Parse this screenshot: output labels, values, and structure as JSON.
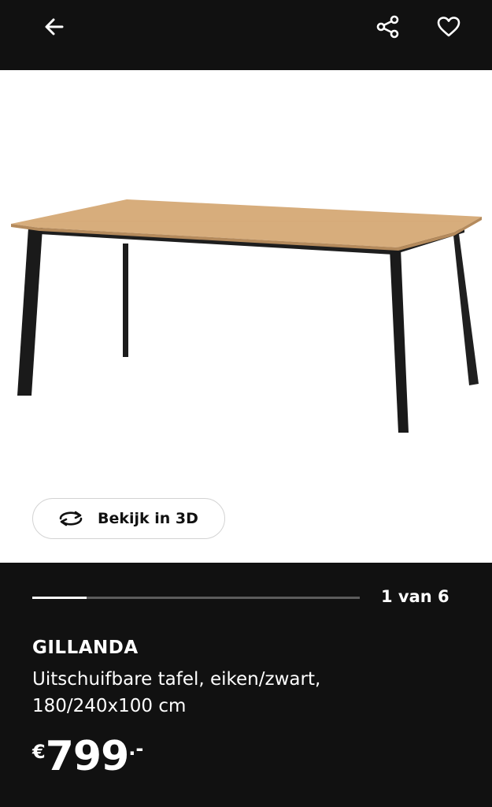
{
  "header": {
    "back_icon": "arrow-left-icon",
    "share_icon": "share-icon",
    "favorite_icon": "heart-icon"
  },
  "gallery": {
    "view3d_label": "Bekijk in 3D",
    "view3d_icon": "rotate-3d-icon",
    "counter": "1 van 6",
    "current": 1,
    "total": 6
  },
  "product": {
    "name": "GILLANDA",
    "description": "Uitschuifbare tafel, eiken/zwart, 180/240x100 cm",
    "price_currency": "€",
    "price_amount": "799",
    "price_decimals": ".-"
  },
  "colors": {
    "background": "#111111",
    "text": "#ffffff",
    "tabletop": "#d7ad7c",
    "legs": "#202020"
  }
}
